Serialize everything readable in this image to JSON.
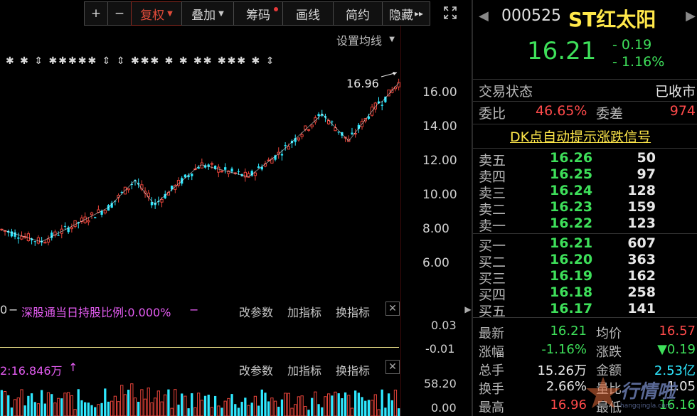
{
  "toolbar": {
    "plus": "+",
    "minus": "−",
    "fuquan": "复权",
    "diejia": "叠加",
    "chouma": "筹码",
    "huaxian": "画线",
    "jianyue": "简约",
    "yincang": "隐藏",
    "yincang_arrows": "▸▸"
  },
  "chart": {
    "ma_settings": "设置均线",
    "high_label": "16.96",
    "price_ticks": [
      "16.00",
      "14.00",
      "12.00",
      "10.00",
      "8.00",
      "6.00"
    ],
    "markers": "✱ ✱ ⇕ ✱✱✱✱✱ ⇕ ⇕ ✱✱✱ ✱ ✱ ✱✱ ✱✱✱ ✱ ⇕"
  },
  "indicator": {
    "left_value": "0",
    "text": "深股通当日持股比例:0.000%",
    "dash": "−",
    "change_params": "改参数",
    "add_indicator": "加指标",
    "switch_indicator": "换指标",
    "close": "✕",
    "val_top": "0.03",
    "val_bottom": "-0.01"
  },
  "volume": {
    "text": "2:16.846万",
    "arrow": "↑",
    "change_params": "改参数",
    "add_indicator": "加指标",
    "switch_indicator": "换指标",
    "close": "✕",
    "val_top": "58.20",
    "val_bottom": "0.00"
  },
  "stock": {
    "code": "000525",
    "name": "ST红太阳",
    "price": "16.21",
    "change_abs": "- 0.19",
    "change_pct": "- 1.16%",
    "nav_left": "◀",
    "nav_right": "▶"
  },
  "status": {
    "label": "交易状态",
    "value": "已收市"
  },
  "ratio": {
    "weibi_label": "委比",
    "weibi_value": "46.65%",
    "weicha_label": "委差",
    "weicha_value": "974"
  },
  "dk": "DK点自动提示涨跌信号",
  "sell": [
    {
      "label": "卖五",
      "price": "16.26",
      "vol": "50"
    },
    {
      "label": "卖四",
      "price": "16.25",
      "vol": "97"
    },
    {
      "label": "卖三",
      "price": "16.24",
      "vol": "128"
    },
    {
      "label": "卖二",
      "price": "16.23",
      "vol": "159"
    },
    {
      "label": "卖一",
      "price": "16.22",
      "vol": "123"
    }
  ],
  "buy": [
    {
      "label": "买一",
      "price": "16.21",
      "vol": "607"
    },
    {
      "label": "买二",
      "price": "16.20",
      "vol": "363"
    },
    {
      "label": "买三",
      "price": "16.19",
      "vol": "162"
    },
    {
      "label": "买四",
      "price": "16.18",
      "vol": "258"
    },
    {
      "label": "买五",
      "price": "16.17",
      "vol": "141"
    }
  ],
  "stats": [
    {
      "l1": "最新",
      "v1": "16.21",
      "c1": "green",
      "l2": "均价",
      "v2": "16.57",
      "c2": "red"
    },
    {
      "l1": "涨幅",
      "v1": "-1.16%",
      "c1": "green",
      "l2": "涨跌",
      "v2": "▼0.19",
      "c2": "green"
    },
    {
      "l1": "总手",
      "v1": "15.26万",
      "c1": "white",
      "l2": "金额",
      "v2": "2.53亿",
      "c2": "cyan"
    },
    {
      "l1": "换手",
      "v1": "2.66%",
      "c1": "white",
      "l2": "量比",
      "v2": "1.05",
      "c2": "white"
    },
    {
      "l1": "最高",
      "v1": "16.96",
      "c1": "red",
      "l2": "最低",
      "v2": "16.16",
      "c2": "green"
    }
  ],
  "watermark": {
    "text": "行情啦",
    "url": "hangqingla.com"
  },
  "colors": {
    "up": "#e8443a",
    "down": "#2ee8ff",
    "ma": "#ffffff"
  }
}
